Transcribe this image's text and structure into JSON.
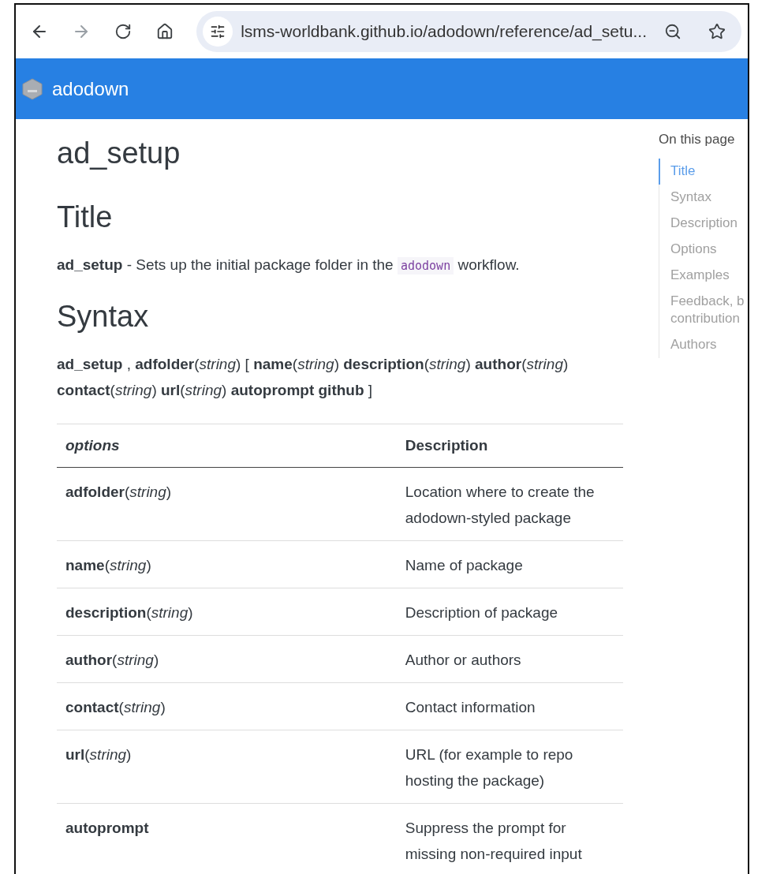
{
  "browser": {
    "url": "lsms-worldbank.github.io/adodown/reference/ad_setu..."
  },
  "navbar": {
    "brand": "adodown"
  },
  "page_title": "ad_setup",
  "sections": [
    {
      "heading": "Title",
      "paragraph": [
        {
          "kind": "text",
          "text": "**ad_setup** - Sets up the initial package folder in the "
        },
        {
          "kind": "code",
          "text": "adodown"
        },
        {
          "kind": "text",
          "text": " workflow."
        }
      ]
    },
    {
      "heading": "Syntax",
      "paragraph": [
        {
          "kind": "text",
          "text": "**ad_setup** , **adfolder**(*string*) [ **name**(*string*) **description**(*string*) **author**(*string*) **contact**(*string*) **url**(*string*) **autoprompt** **github** ]"
        }
      ]
    }
  ],
  "table": {
    "columns": [
      "options",
      "Description"
    ],
    "rows": [
      {
        "option": "**adfolder**(*string*)",
        "description": "Location where to create the adodown-styled package"
      },
      {
        "option": "**name**(*string*)",
        "description": "Name of package"
      },
      {
        "option": "**description**(*string*)",
        "description": "Description of package"
      },
      {
        "option": "**author**(*string*)",
        "description": "Author or authors"
      },
      {
        "option": "**contact**(*string*)",
        "description": "Contact information"
      },
      {
        "option": "**url**(*string*)",
        "description": "URL (for example to repo hosting the package)"
      },
      {
        "option": "**autoprompt**",
        "description": "Suppress the prompt for missing non-required input"
      }
    ]
  },
  "toc": {
    "title": "On this page",
    "items": [
      {
        "label": "Title",
        "selected": true
      },
      {
        "label": "Syntax",
        "selected": false
      },
      {
        "label": "Description",
        "selected": false
      },
      {
        "label": "Options",
        "selected": false
      },
      {
        "label": "Examples",
        "selected": false
      },
      {
        "label": "Feedback, b\ncontribution",
        "selected": false
      },
      {
        "label": "Authors",
        "selected": false
      }
    ]
  }
}
